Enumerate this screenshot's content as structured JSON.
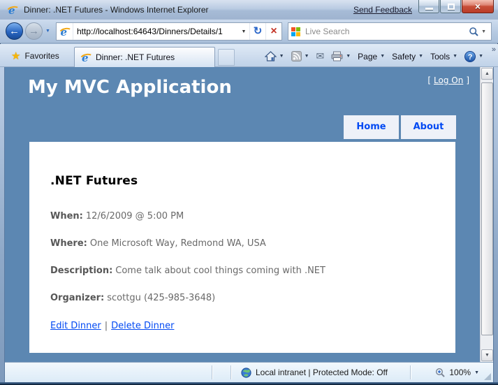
{
  "titlebar": {
    "title": "Dinner: .NET Futures - Windows Internet Explorer",
    "send_feedback": "Send Feedback"
  },
  "navbar": {
    "url": "http://localhost:64643/Dinners/Details/1",
    "search_placeholder": "Live Search"
  },
  "tabbar": {
    "favorites": "Favorites",
    "active_tab": "Dinner: .NET Futures",
    "page_menu": "Page",
    "safety_menu": "Safety",
    "tools_menu": "Tools"
  },
  "page": {
    "app_title": "My MVC Application",
    "logon": {
      "prefix": "[",
      "link": "Log On",
      "suffix": "]"
    },
    "menu": [
      {
        "label": "Home"
      },
      {
        "label": "About"
      }
    ],
    "heading": ".NET Futures",
    "details": [
      {
        "label": "When:",
        "value": "12/6/2009 @ 5:00 PM"
      },
      {
        "label": "Where:",
        "value": "One Microsoft Way, Redmond WA, USA"
      },
      {
        "label": "Description:",
        "value": "Come talk about cool things coming with .NET"
      },
      {
        "label": "Organizer:",
        "value": "scottgu (425-985-3648)"
      }
    ],
    "links": {
      "edit": "Edit Dinner",
      "separator": "|",
      "delete": "Delete Dinner"
    }
  },
  "statusbar": {
    "zone": "Local intranet | Protected Mode: Off",
    "zoom": "100%"
  },
  "icons": {
    "back": "←",
    "forward": "→",
    "dropdown": "▼",
    "refresh": "↻",
    "stop": "×",
    "mail": "✉",
    "star": "★",
    "help": "?",
    "overflow": "»",
    "scroll_up": "▲",
    "scroll_down": "▼",
    "close": "×",
    "ie_e": "e"
  },
  "colors": {
    "header_blue": "#5c87b2",
    "link_blue": "#034af3",
    "body_text": "#696969"
  }
}
